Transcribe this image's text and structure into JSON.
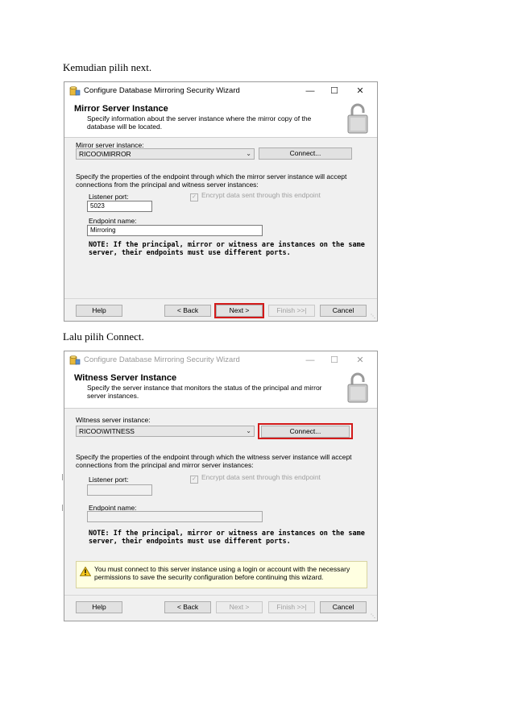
{
  "captions": {
    "first": "Kemudian pilih next.",
    "second": "Lalu pilih Connect."
  },
  "dialog1": {
    "window_title": "Configure Database Mirroring Security Wizard",
    "window_buttons": {
      "minimize": "—",
      "maximize": "☐",
      "close": "✕"
    },
    "header_title": "Mirror Server Instance",
    "header_desc": "Specify information about the server instance where the mirror copy of the database will be located.",
    "instance_label": "Mirror server instance:",
    "instance_value": "RICOO\\MIRROR",
    "connect_label": "Connect...",
    "endpoint_desc": "Specify the properties of the endpoint through which the mirror server instance will accept connections from the principal and witness server instances:",
    "listener_port_label": "Listener port:",
    "listener_port_value": "5023",
    "encrypt_label": "Encrypt data sent through this endpoint",
    "endpoint_name_label": "Endpoint name:",
    "endpoint_name_value": "Mirroring",
    "note": "NOTE: If the principal, mirror or witness are instances on the same server, their endpoints must use different ports.",
    "buttons": {
      "help": "Help",
      "back": "< Back",
      "next": "Next >",
      "finish": "Finish >>|",
      "cancel": "Cancel"
    }
  },
  "dialog2": {
    "window_title": "Configure Database Mirroring Security Wizard",
    "window_buttons": {
      "minimize": "—",
      "maximize": "☐",
      "close": "✕"
    },
    "header_title": "Witness Server Instance",
    "header_desc": "Specify the server instance that monitors the status of the principal and mirror server instances.",
    "instance_label": "Witness server instance:",
    "instance_value": "RICOO\\WITNESS",
    "connect_label": "Connect...",
    "endpoint_desc": "Specify the properties of the endpoint through which the witness server instance will accept connections from the principal and mirror server instances:",
    "listener_port_label": "Listener port:",
    "listener_port_value": "",
    "encrypt_label": "Encrypt data sent through this endpoint",
    "endpoint_name_label": "Endpoint name:",
    "endpoint_name_value": "",
    "note": "NOTE: If the principal, mirror or witness are instances on the same server, their endpoints must use different ports.",
    "warning": "You must connect to this server instance using a login or account with the necessary permissions to save the security configuration before continuing this wizard.",
    "buttons": {
      "help": "Help",
      "back": "< Back",
      "next": "Next >",
      "finish": "Finish >>|",
      "cancel": "Cancel"
    }
  },
  "colors": {
    "highlight": "#d31a1a",
    "dialog_bg": "#f0f0f0",
    "warning_bg": "#ffffe1"
  }
}
